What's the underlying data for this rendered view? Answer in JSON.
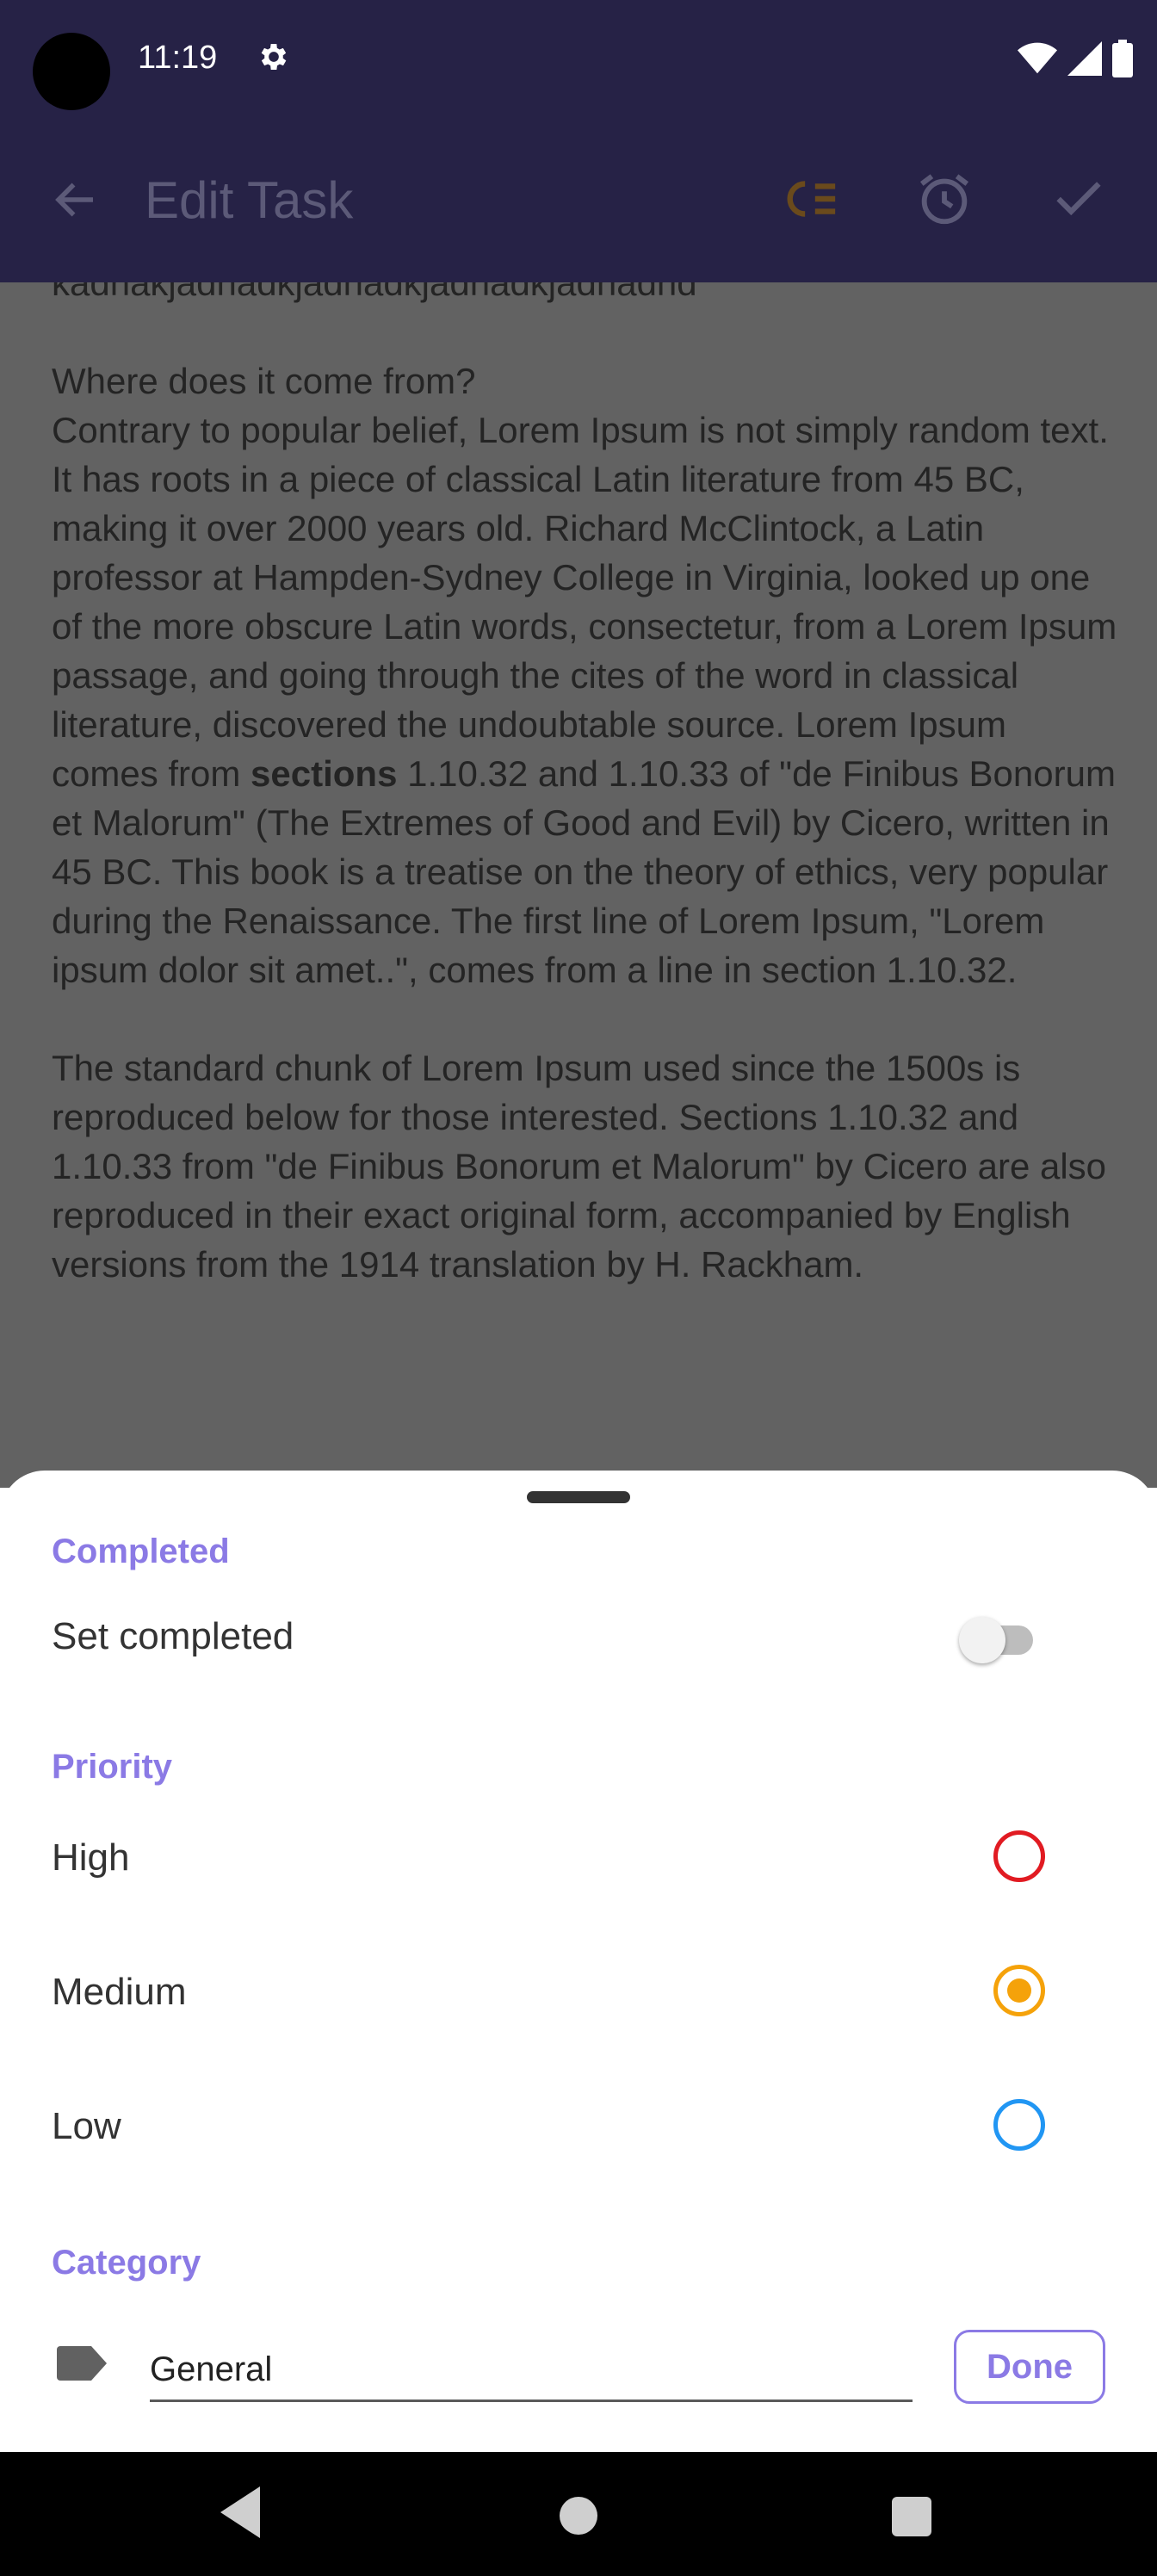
{
  "status_bar": {
    "time": "11:19"
  },
  "app_bar": {
    "title": "Edit Task"
  },
  "content": {
    "partial_line": "kadhakjadhadkjadhadkjadhadkjadhadhd",
    "para1_heading": "Where does it come from?",
    "para1_a": "Contrary to popular belief, Lorem Ipsum is not simply random text. It has roots in a piece of classical Latin literature from 45 BC, making it over 2000 years old. Richard McClintock, a Latin professor at Hampden-Sydney College in Virginia, looked up one of the more obscure Latin words, consectetur, from a Lorem Ipsum passage, and going through the cites of the word in classical literature, discovered the undoubtable source. Lorem Ipsum comes from ",
    "para1_bold": "sections",
    "para1_b": " 1.10.32 and 1.10.33 of \"de Finibus Bonorum et Malorum\" (The Extremes of Good and Evil) by Cicero, written in 45 BC. This book is a treatise on the theory of ethics, very popular during the Renaissance. The first line of Lorem Ipsum, \"Lorem ipsum dolor sit amet..\", comes from a line in section 1.10.32.",
    "para2": "The standard chunk of Lorem Ipsum used since the 1500s is reproduced below for those interested. Sections 1.10.32 and 1.10.33 from \"de Finibus Bonorum et Malorum\" by Cicero are also reproduced in their exact original form, accompanied by English versions from the 1914 translation by H. Rackham."
  },
  "sheet": {
    "completed_title": "Completed",
    "set_completed_label": "Set completed",
    "set_completed_on": false,
    "priority_title": "Priority",
    "priority_high": "High",
    "priority_medium": "Medium",
    "priority_low": "Low",
    "selected_priority": "Medium",
    "category_title": "Category",
    "category_value": "General",
    "done_label": "Done"
  },
  "colors": {
    "accent": "#8b7ae5",
    "high": "#e11b22",
    "medium": "#f5a20a",
    "low": "#2196f3"
  },
  "icons": {
    "back": "arrow-back-icon",
    "priority": "priority-list-icon",
    "alarm": "alarm-icon",
    "save": "check-icon",
    "category": "label-tag-icon"
  }
}
